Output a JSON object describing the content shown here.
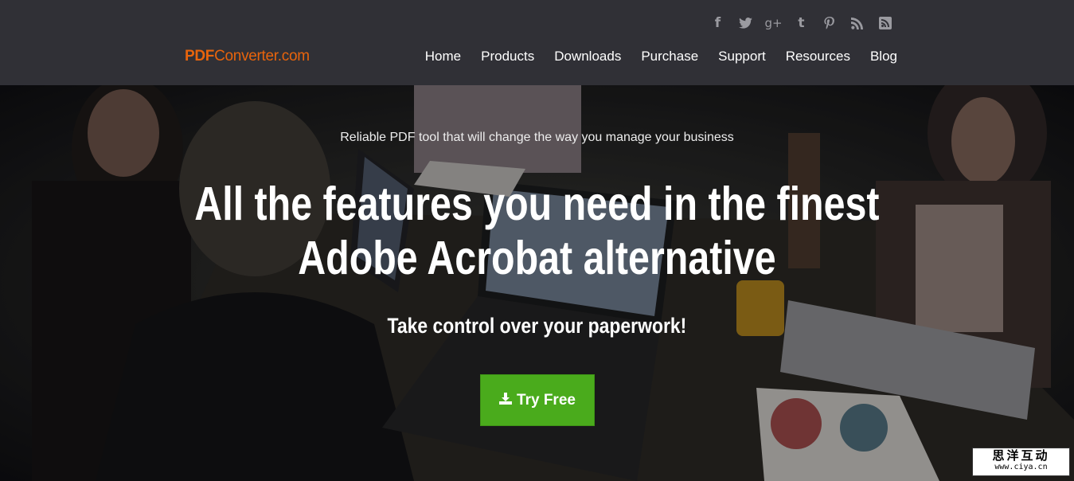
{
  "header": {
    "logo": {
      "bold": "PDF",
      "rest": "Converter.com"
    },
    "social": [
      {
        "name": "facebook-icon",
        "glyph": "f"
      },
      {
        "name": "twitter-icon",
        "glyph": "🐦"
      },
      {
        "name": "google-plus-icon",
        "glyph": "g+"
      },
      {
        "name": "tumblr-icon",
        "glyph": "t"
      },
      {
        "name": "pinterest-icon",
        "glyph": "p"
      },
      {
        "name": "rss-icon",
        "glyph": "◔"
      },
      {
        "name": "rss-square-icon",
        "glyph": "▣"
      }
    ],
    "nav": [
      "Home",
      "Products",
      "Downloads",
      "Purchase",
      "Support",
      "Resources",
      "Blog"
    ]
  },
  "hero": {
    "tagline": "Reliable PDF tool that will change the way you manage your business",
    "headline_line1": "All the features you need in the finest",
    "headline_line2": "Adobe Acrobat alternative",
    "subheadline": "Take control over your paperwork!",
    "cta_label": "Try Free"
  },
  "watermark": {
    "line1": "思洋互动",
    "line2": "www.ciya.cn"
  },
  "colors": {
    "header_bg": "#303036",
    "logo": "#e8640c",
    "cta_bg": "#4aab1c"
  }
}
